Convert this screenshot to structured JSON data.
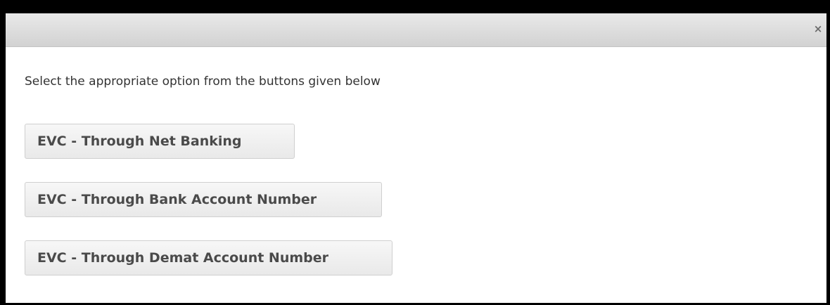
{
  "dialog": {
    "close_glyph": "×",
    "instruction": "Select the appropriate option from the buttons given below",
    "options": [
      {
        "label": "EVC - Through Net Banking"
      },
      {
        "label": "EVC - Through Bank Account Number"
      },
      {
        "label": "EVC - Through Demat Account Number"
      }
    ]
  },
  "colors": {
    "backdrop": "#000000",
    "dialog_bg": "#ffffff",
    "titlebar": "#dcdcdc",
    "button_bg": "#efefef",
    "button_text": "#4a4a4a",
    "text": "#333333"
  },
  "icons": {
    "close": "close-icon"
  }
}
